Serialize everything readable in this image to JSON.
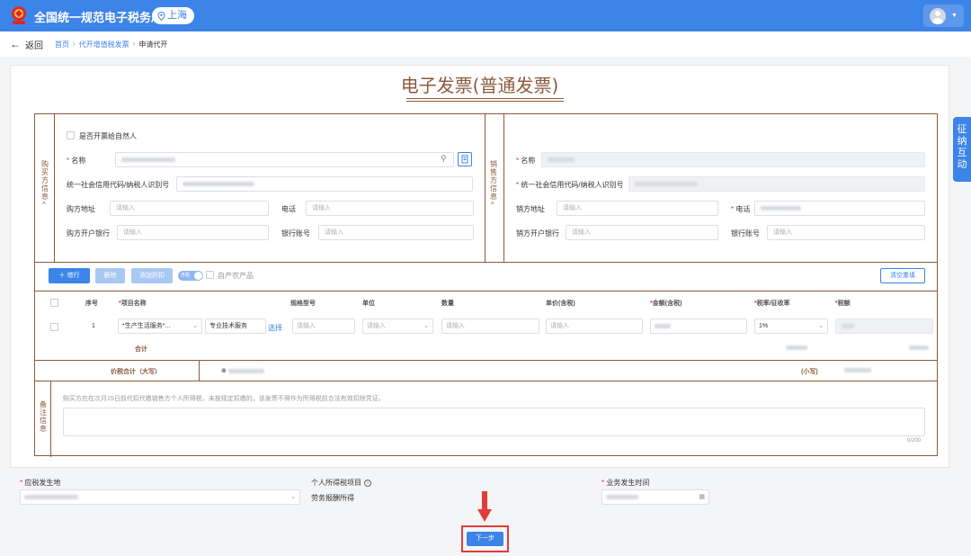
{
  "header": {
    "site_title": "全国统一规范电子税务局",
    "region": "上海",
    "icons": {
      "emblem": "tax-emblem-icon",
      "pin": "map-pin-icon",
      "user": "user-avatar-icon",
      "caret": "caret-down-icon"
    }
  },
  "nav": {
    "back_label": "返回",
    "breadcrumbs": [
      "首页",
      "代开增值税发票",
      "申请代开"
    ],
    "separator": "›"
  },
  "invoice": {
    "title": "电子发票(普通发票)",
    "buyer": {
      "section_label": "购买方信息",
      "natural_person_label": "是否开票给自然人",
      "name_label": "名称",
      "taxid_label": "统一社会信用代码/纳税人识别号",
      "address_label": "购方地址",
      "address_placeholder": "请输入",
      "phone_label": "电话",
      "phone_placeholder": "请输入",
      "bank_label": "购方开户银行",
      "bank_placeholder": "请输入",
      "account_label": "银行账号",
      "account_placeholder": "请输入"
    },
    "seller": {
      "section_label": "销售方信息",
      "name_label": "名称",
      "taxid_label": "统一社会信用代码/纳税人识别号",
      "address_label": "销方地址",
      "address_placeholder": "请输入",
      "phone_label": "电话",
      "bank_label": "销方开户银行",
      "bank_placeholder": "请输入",
      "account_label": "银行账号",
      "account_placeholder": "请输入"
    },
    "toolbar": {
      "add_row": "增行",
      "delete": "删除",
      "add_discount": "添加折扣",
      "toggle_label": "含税",
      "farm_product_label": "自产农产品",
      "clear": "清空重填"
    },
    "table": {
      "headers": [
        "序号",
        "项目名称",
        "规格型号",
        "单位",
        "数量",
        "单价(含税)",
        "金额(含税)",
        "税率/征收率",
        "税额"
      ],
      "required_headers": [
        false,
        true,
        false,
        false,
        false,
        false,
        true,
        true,
        true
      ],
      "row": {
        "index": "1",
        "item_name": "*生产生活服务*...",
        "service": "专业技术服务",
        "select_link": "选择",
        "spec_placeholder": "请输入",
        "unit_placeholder": "请输入",
        "qty_placeholder": "请输入",
        "price_placeholder": "请输入",
        "tax_rate": "1%"
      },
      "total_label": "合计"
    },
    "price_total": {
      "label": "价税合计（大写）",
      "small_label": "(小写)"
    },
    "remarks": {
      "section_label": "备注信息",
      "note": "购买方应在次月15日前代扣代缴销售方个人所得税，未按规定扣缴的，该发票不得作为所得税前合法有效扣除凭证。",
      "counter": "0/200"
    }
  },
  "side_tab": "征纳互动",
  "bottom": {
    "tax_location_label": "应税发生地",
    "income_item_label": "个人所得税项目",
    "income_item_value": "劳务报酬所得",
    "business_time_label": "业务发生时间",
    "info_icon": "info-icon",
    "calendar_icon": "calendar-icon"
  },
  "next_button": "下一步",
  "colors": {
    "brand": "#3c84e8",
    "invoice_brown": "#8b5a3c",
    "highlight_red": "#e23b3b"
  }
}
